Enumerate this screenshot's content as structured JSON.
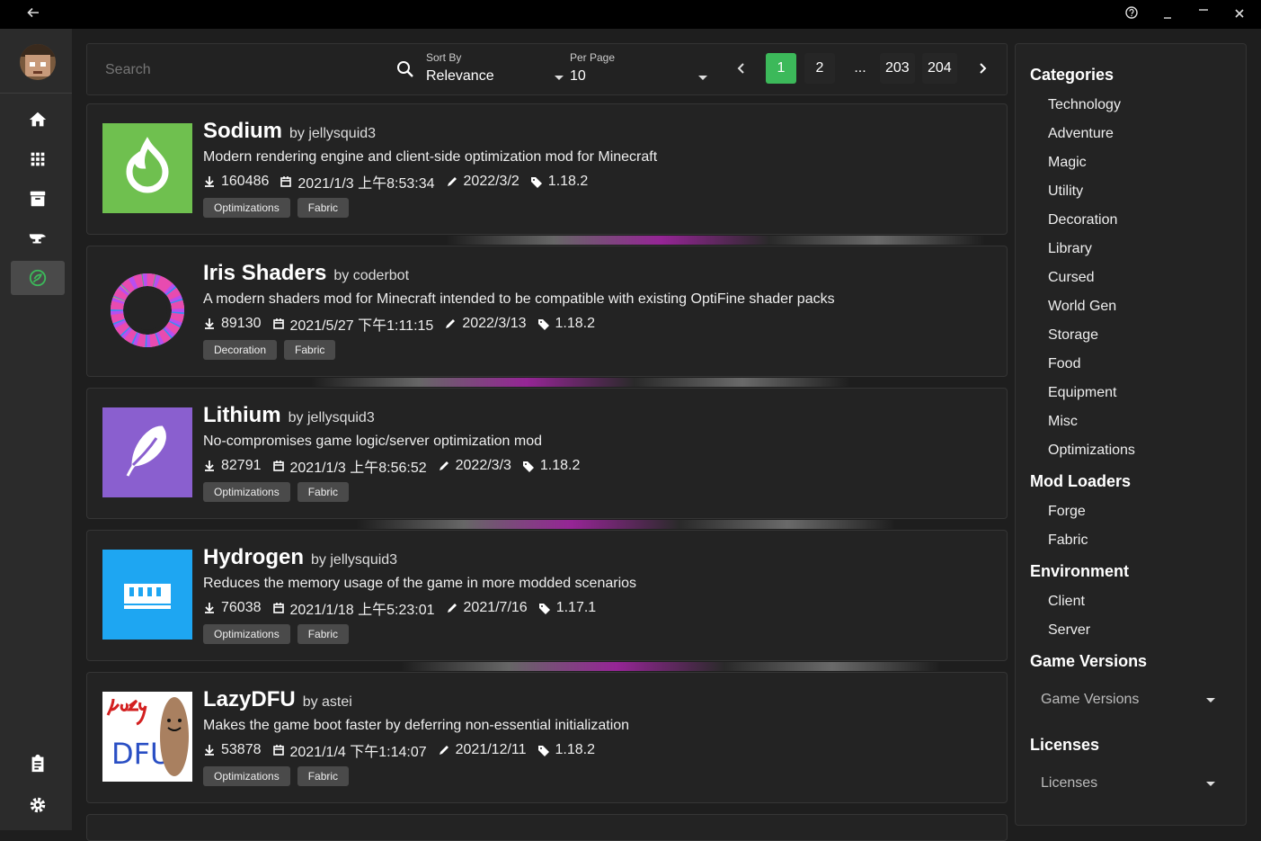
{
  "search": {
    "placeholder": "Search"
  },
  "sort": {
    "label": "Sort By",
    "value": "Relevance"
  },
  "perpage": {
    "label": "Per Page",
    "value": "10"
  },
  "pagination": {
    "pages": [
      "1",
      "2",
      "...",
      "203",
      "204"
    ],
    "active": "1"
  },
  "mods": [
    {
      "name": "Sodium",
      "author": "by jellysquid3",
      "description": "Modern rendering engine and client-side optimization mod for Minecraft",
      "downloads": "160486",
      "created": "2021/1/3 上午8:53:34",
      "updated": "2022/3/2",
      "version": "1.18.2",
      "tags": [
        "Optimizations",
        "Fabric"
      ]
    },
    {
      "name": "Iris Shaders",
      "author": "by coderbot",
      "description": "A modern shaders mod for Minecraft intended to be compatible with existing OptiFine shader packs",
      "downloads": "89130",
      "created": "2021/5/27 下午1:11:15",
      "updated": "2022/3/13",
      "version": "1.18.2",
      "tags": [
        "Decoration",
        "Fabric"
      ]
    },
    {
      "name": "Lithium",
      "author": "by jellysquid3",
      "description": "No-compromises game logic/server optimization mod",
      "downloads": "82791",
      "created": "2021/1/3 上午8:56:52",
      "updated": "2022/3/3",
      "version": "1.18.2",
      "tags": [
        "Optimizations",
        "Fabric"
      ]
    },
    {
      "name": "Hydrogen",
      "author": "by jellysquid3",
      "description": "Reduces the memory usage of the game in more modded scenarios",
      "downloads": "76038",
      "created": "2021/1/18 上午5:23:01",
      "updated": "2021/7/16",
      "version": "1.17.1",
      "tags": [
        "Optimizations",
        "Fabric"
      ]
    },
    {
      "name": "LazyDFU",
      "author": "by astei",
      "description": "Makes the game boot faster by deferring non-essential initialization",
      "downloads": "53878",
      "created": "2021/1/4 下午1:14:07",
      "updated": "2021/12/11",
      "version": "1.18.2",
      "tags": [
        "Optimizations",
        "Fabric"
      ]
    }
  ],
  "filters": {
    "categories_title": "Categories",
    "categories": [
      "Technology",
      "Adventure",
      "Magic",
      "Utility",
      "Decoration",
      "Library",
      "Cursed",
      "World Gen",
      "Storage",
      "Food",
      "Equipment",
      "Misc",
      "Optimizations"
    ],
    "loaders_title": "Mod Loaders",
    "loaders": [
      "Forge",
      "Fabric"
    ],
    "environment_title": "Environment",
    "environment": [
      "Client",
      "Server"
    ],
    "versions_title": "Game Versions",
    "versions_placeholder": "Game Versions",
    "licenses_title": "Licenses",
    "licenses_placeholder": "Licenses"
  },
  "colors": {
    "accent": "#3cb95a",
    "sodium": "#6fc04f",
    "lithium": "#8a5fcf",
    "hydrogen": "#1ea6f2"
  }
}
